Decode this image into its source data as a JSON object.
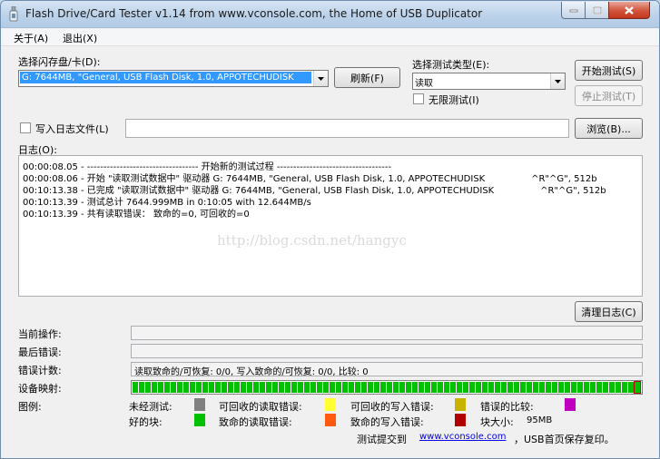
{
  "window": {
    "title": "Flash Drive/Card Tester v1.14 from www.vconsole.com, the Home of USB Duplicator"
  },
  "menu": {
    "about": "关于(A)",
    "exit": "退出(X)"
  },
  "disk": {
    "label": "选择闪存盘/卡(D):",
    "selected": "G: 7644MB, \"General, USB Flash Disk, 1.0, APPOTECHUDISK"
  },
  "refresh_button": "刷新(F)",
  "test_type": {
    "label": "选择测试类型(E):",
    "selected": "读取"
  },
  "infinite_test": {
    "label": "无限测试(I)",
    "checked": false
  },
  "start_button": "开始测试(S)",
  "stop_button": "停止测试(T)",
  "write_log": {
    "label": "写入日志文件(L)",
    "checked": false,
    "path": ""
  },
  "browse_button": "浏览(B)...",
  "log": {
    "label": "日志(O):",
    "lines": [
      "00:00:08.05 - ---------------------------------- 开始新的测试过程 -----------------------------------",
      "00:00:08.06 - 开始 \"读取测试数据中\" 驱动器 G: 7644MB, \"General, USB Flash Disk, 1.0, APPOTECHUDISK                ^R\"^G\", 512b",
      "00:10:13.38 - 已完成 \"读取测试数据中\" 驱动器 G: 7644MB, \"General, USB Flash Disk, 1.0, APPOTECHUDISK                ^R\"^G\", 512b",
      "00:10:13.39 - 测试总计 7644.999MB in 0:10:05 with 12.644MB/s",
      "00:10:13.39 - 共有读取错误： 致命的=0, 可回收的=0"
    ],
    "watermark": "http://blog.csdn.net/hangyc"
  },
  "clear_log_button": "清理日志(C)",
  "status": {
    "current_op_label": "当前操作:",
    "current_op_value": "",
    "last_error_label": "最后错误:",
    "last_error_value": "",
    "error_count_label": "错误计数:",
    "error_count_value": "读取致命的/可恢复:  0/0, 写入致命的/可恢复:  0/0, 比较:  0",
    "device_map_label": "设备映射:",
    "device_map_progress": 1.0
  },
  "legend": {
    "label": "图例:",
    "untested": "未经测试:",
    "recoverable_read": "可回收的读取错误:",
    "recoverable_write": "可回收的写入错误:",
    "compare_error": "错误的比较:",
    "good_block": "好的块:",
    "fatal_read": "致命的读取错误:",
    "fatal_write": "致命的写入错误:",
    "block_size_label": "块大小:",
    "block_size_value": "95MB",
    "colors": {
      "untested": "#808080",
      "recoverable_read": "#ffff33",
      "recoverable_write": "#c8b400",
      "compare_error": "#c000c0",
      "good_block": "#00c000",
      "fatal_read": "#ff5a10",
      "fatal_write": "#b00000"
    }
  },
  "footer": {
    "prefix": "测试提交到",
    "link": "www.vconsole.com",
    "suffix": "，USB首页保存复印。"
  }
}
